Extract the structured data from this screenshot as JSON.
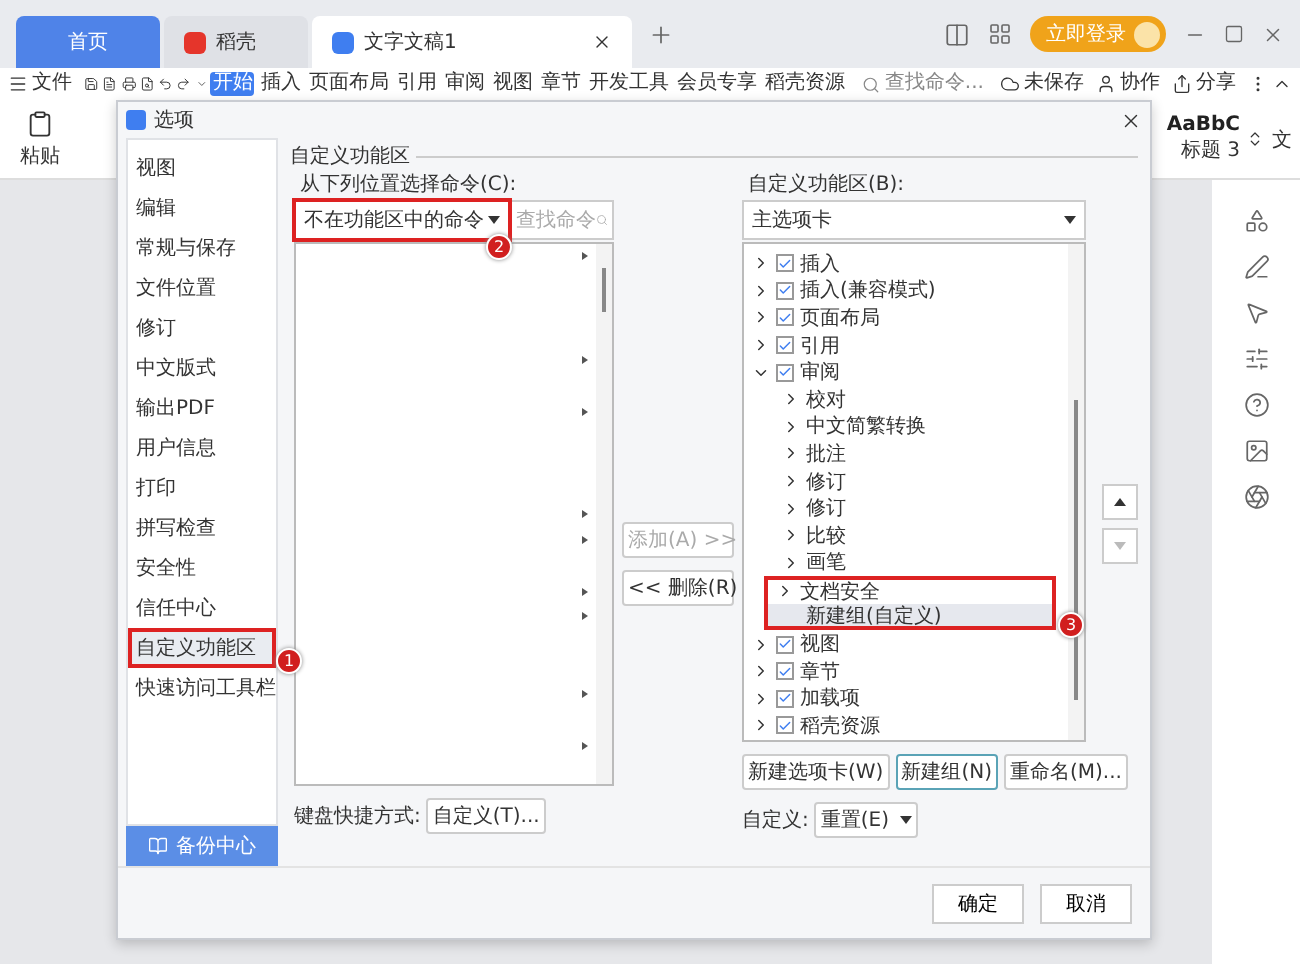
{
  "tabs": [
    {
      "label": "首页",
      "kind": "home",
      "selected": false
    },
    {
      "label": "稻壳",
      "kind": "docer",
      "selected": false
    },
    {
      "label": "文字文稿1",
      "kind": "doc",
      "selected": true
    }
  ],
  "login_button": "立即登录",
  "menu": {
    "file": "文件",
    "tabs": [
      {
        "label": "开始",
        "selected": true
      },
      {
        "label": "插入",
        "selected": false
      },
      {
        "label": "页面布局",
        "selected": false
      },
      {
        "label": "引用",
        "selected": false
      },
      {
        "label": "审阅",
        "selected": false
      },
      {
        "label": "视图",
        "selected": false
      },
      {
        "label": "章节",
        "selected": false
      },
      {
        "label": "开发工具",
        "selected": false
      },
      {
        "label": "会员专享",
        "selected": false
      },
      {
        "label": "稻壳资源",
        "selected": false
      }
    ],
    "search_placeholder": "查找命令...",
    "actions": [
      "未保存",
      "协作",
      "分享"
    ]
  },
  "ribbon": {
    "paste": "粘贴",
    "style_preview": "AaBbC",
    "style_name": "标题 3",
    "text_label": "文"
  },
  "dialog": {
    "title": "选项",
    "nav": [
      {
        "label": "视图",
        "selected": false
      },
      {
        "label": "编辑",
        "selected": false
      },
      {
        "label": "常规与保存",
        "selected": false
      },
      {
        "label": "文件位置",
        "selected": false
      },
      {
        "label": "修订",
        "selected": false
      },
      {
        "label": "中文版式",
        "selected": false
      },
      {
        "label": "输出PDF",
        "selected": false
      },
      {
        "label": "用户信息",
        "selected": false
      },
      {
        "label": "打印",
        "selected": false
      },
      {
        "label": "拼写检查",
        "selected": false
      },
      {
        "label": "安全性",
        "selected": false
      },
      {
        "label": "信任中心",
        "selected": false
      },
      {
        "label": "自定义功能区",
        "selected": true
      },
      {
        "label": "快速访问工具栏",
        "selected": false
      }
    ],
    "nav_callout": "1",
    "backup": "备份中心",
    "section": "自定义功能区",
    "left": {
      "label": "从下列位置选择命令(C):",
      "dropdown": "不在功能区中的命令",
      "callout": "2",
      "search_placeholder": "查找命令",
      "rows": [
        {
          "kind": "submenu"
        },
        {
          "kind": "plain"
        },
        {
          "kind": "plain"
        },
        {
          "kind": "plain"
        },
        {
          "kind": "submenu"
        },
        {
          "kind": "plain"
        },
        {
          "kind": "submenu"
        },
        {
          "kind": "plain"
        },
        {
          "kind": "plain"
        },
        {
          "kind": "plain"
        },
        {
          "kind": "submenu"
        },
        {
          "kind": "submenu"
        },
        {
          "kind": "plain"
        },
        {
          "kind": "submenu"
        },
        {
          "kind": "submenu"
        },
        {
          "kind": "plain"
        },
        {
          "kind": "plain"
        },
        {
          "kind": "submenu"
        },
        {
          "kind": "plain"
        },
        {
          "kind": "submenu"
        },
        {
          "kind": "plain"
        }
      ]
    },
    "add_button": {
      "label": "添加(A) >>",
      "disabled": true
    },
    "remove_button": {
      "label": "<< 删除(R)",
      "disabled": false
    },
    "right": {
      "label": "自定义功能区(B):",
      "dropdown": "主选项卡",
      "callout": "3",
      "tree": [
        {
          "label": "插入",
          "checked": true,
          "expanded": false
        },
        {
          "label": "插入(兼容模式)",
          "checked": true,
          "expanded": false
        },
        {
          "label": "页面布局",
          "checked": true,
          "expanded": false
        },
        {
          "label": "引用",
          "checked": true,
          "expanded": false
        },
        {
          "label": "审阅",
          "checked": true,
          "expanded": true,
          "children": [
            {
              "label": "校对",
              "highlighted": false,
              "selected": false,
              "kind": "group"
            },
            {
              "label": "中文简繁转换",
              "highlighted": false,
              "selected": false,
              "kind": "group"
            },
            {
              "label": "批注",
              "highlighted": false,
              "selected": false,
              "kind": "group"
            },
            {
              "label": "修订",
              "highlighted": false,
              "selected": false,
              "kind": "group"
            },
            {
              "label": "修订",
              "highlighted": false,
              "selected": false,
              "kind": "group"
            },
            {
              "label": "比较",
              "highlighted": false,
              "selected": false,
              "kind": "group"
            },
            {
              "label": "画笔",
              "highlighted": false,
              "selected": false,
              "kind": "group"
            },
            {
              "label": "文档安全",
              "highlighted": true,
              "selected": false,
              "kind": "group"
            },
            {
              "label": "新建组(自定义)",
              "highlighted": true,
              "selected": true,
              "kind": "custom"
            }
          ]
        },
        {
          "label": "视图",
          "checked": true,
          "expanded": false
        },
        {
          "label": "章节",
          "checked": true,
          "expanded": false
        },
        {
          "label": "加载项",
          "checked": true,
          "expanded": false
        },
        {
          "label": "稻壳资源",
          "checked": true,
          "expanded": false
        }
      ]
    },
    "move_up": {
      "disabled": false
    },
    "move_down": {
      "disabled": true
    },
    "tree_buttons": [
      {
        "label": "新建选项卡(W)",
        "selected": false
      },
      {
        "label": "新建组(N)",
        "selected": true
      },
      {
        "label": "重命名(M)...",
        "selected": false
      }
    ],
    "custom_label": "自定义:",
    "reset": "重置(E)",
    "shortcut_label": "键盘快捷方式:",
    "shortcut_button": "自定义(T)...",
    "ok": "确定",
    "cancel": "取消"
  }
}
